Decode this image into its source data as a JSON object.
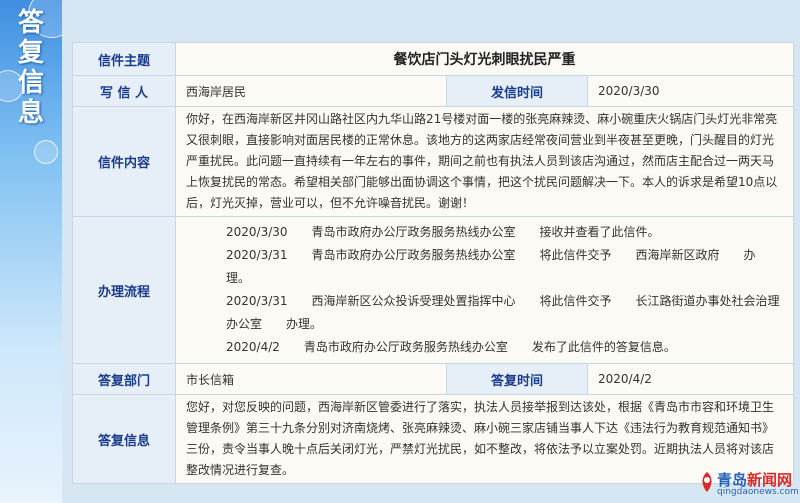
{
  "sidebar": {
    "title": [
      "答",
      "复",
      "信",
      "息"
    ]
  },
  "letter": {
    "subject_label": "信件主题",
    "subject": "餐饮店门头灯光刺眼扰民严重",
    "writer_label": "写 信 人",
    "writer": "西海岸居民",
    "sent_label": "发信时间",
    "sent": "2020/3/30",
    "content_label": "信件内容",
    "content": "你好，在西海岸新区井冈山路社区内九华山路21号楼对面一楼的张亮麻辣烫、麻小碗重庆火锅店门头灯光非常亮又很刺眼，直接影响对面居民楼的正常休息。该地方的这两家店经常夜间营业到半夜甚至更晚，门头醒目的灯光严重扰民。此问题一直持续有一年左右的事件，期间之前也有执法人员到该店沟通过，然而店主配合过一两天马上恢复扰民的常态。希望相关部门能够出面协调这个事情，把这个扰民问题解决一下。本人的诉求是希望10点以后，灯光灭掉，营业可以，但不允许噪音扰民。谢谢！"
  },
  "process": {
    "label": "办理流程",
    "steps": [
      {
        "date": "2020/3/30",
        "org": "青岛市政府办公厅政务服务热线办公室",
        "action": "接收并查看了此信件。"
      },
      {
        "date": "2020/3/31",
        "org": "青岛市政府办公厅政务服务热线办公室",
        "action": "将此信件交予　　西海岸新区政府　　办理。"
      },
      {
        "date": "2020/3/31",
        "org": "西海岸新区公众投诉受理处置指挥中心",
        "action": "将此信件交予　　长江路街道办事处社会治理办公室　　办理。"
      },
      {
        "date": "2020/4/2",
        "org": "青岛市政府办公厅政务服务热线办公室",
        "action": "发布了此信件的答复信息。"
      }
    ]
  },
  "reply": {
    "dept_label": "答复部门",
    "dept": "市长信箱",
    "date_label": "答复时间",
    "date": "2020/4/2",
    "info_label": "答复信息",
    "info": "您好，对您反映的问题，西海岸新区管委进行了落实，执法人员接举报到达该处，根据《青岛市市容和环境卫生管理条例》第三十九条分别对济南烧烤、张亮麻辣烫、麻小碗三家店铺当事人下达《违法行为教育规范通知书》三份，责令当事人晚十点后关闭灯光，严禁灯光扰民，如不整改，将依法予以立案处罚。近期执法人员将对该店整改情况进行复查。"
  },
  "logo": {
    "name_a": "青岛",
    "name_b": "新闻网",
    "url": "qingdaonews.com"
  }
}
